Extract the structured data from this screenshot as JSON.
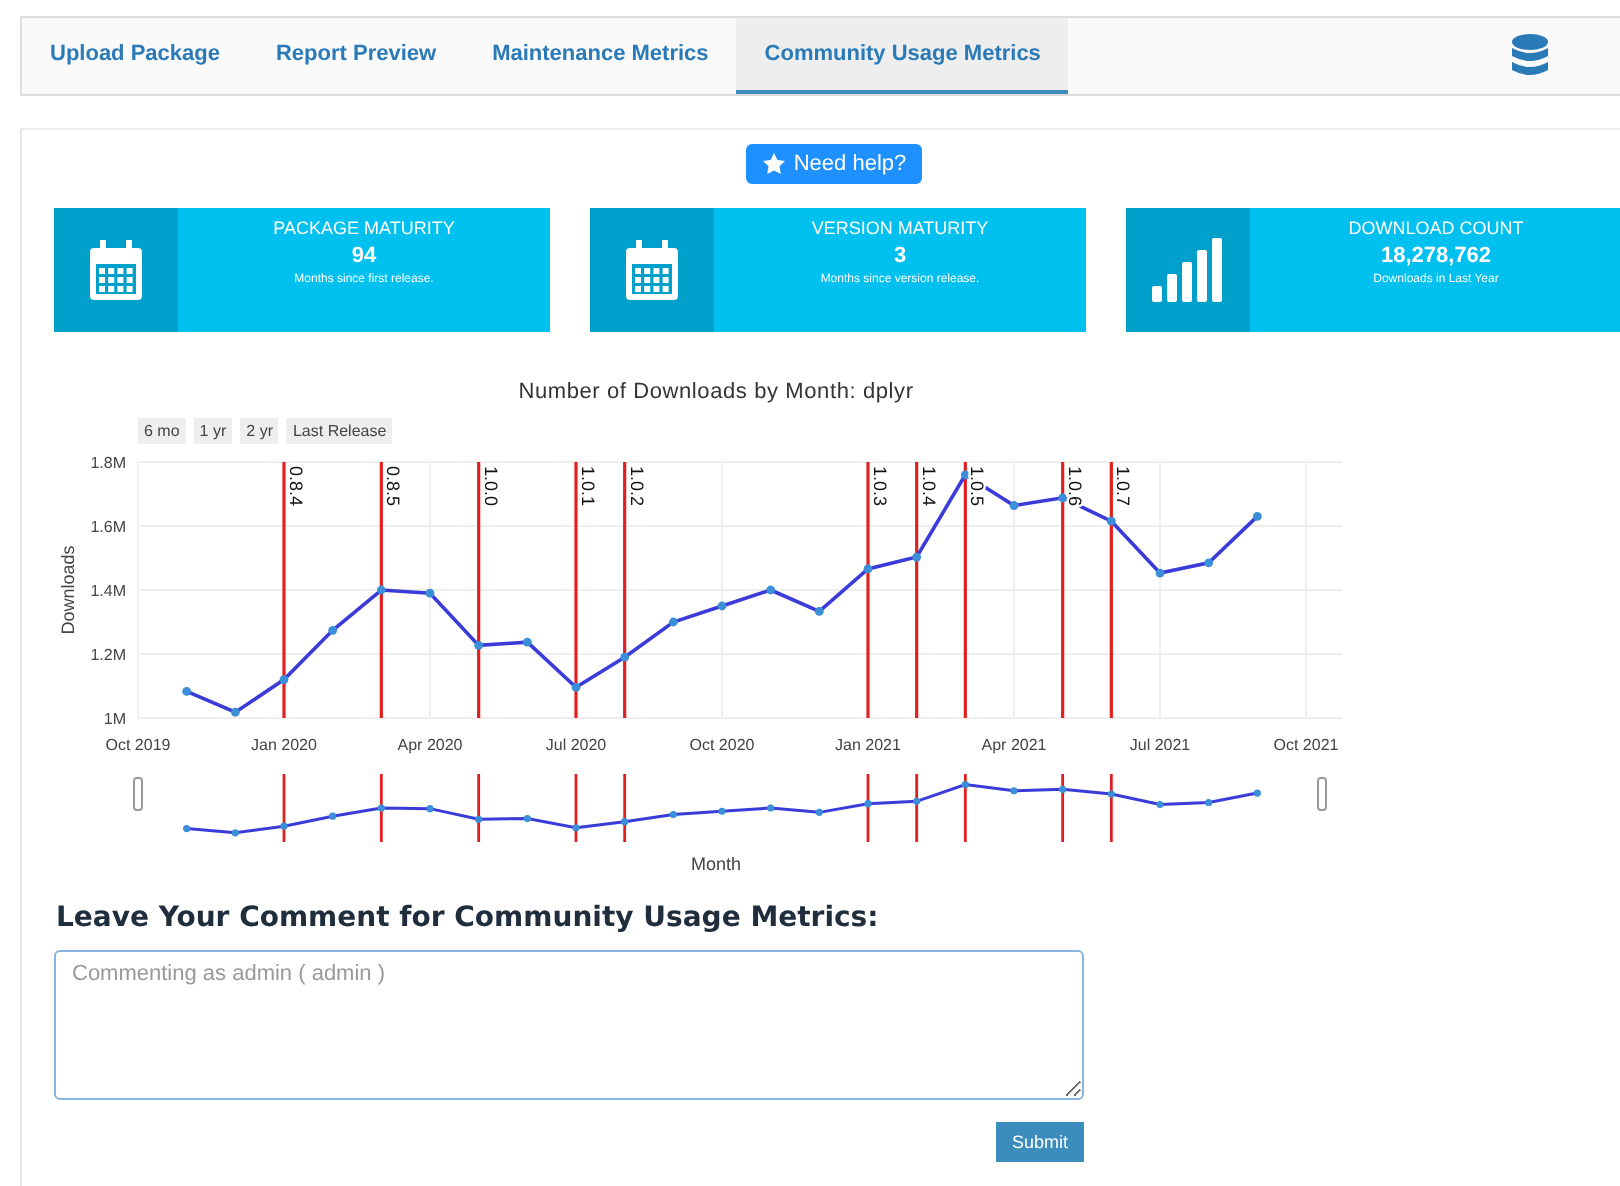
{
  "tabs": [
    {
      "label": "Upload Package",
      "selected": false
    },
    {
      "label": "Report Preview",
      "selected": false
    },
    {
      "label": "Maintenance Metrics",
      "selected": false
    },
    {
      "label": "Community Usage Metrics",
      "selected": true
    }
  ],
  "help_button": "Need help?",
  "cards": [
    {
      "kind": "calendar",
      "title": "PACKAGE MATURITY",
      "value": "94",
      "caption": "Months since first release."
    },
    {
      "kind": "calendar",
      "title": "VERSION MATURITY",
      "value": "3",
      "caption": "Months since version release."
    },
    {
      "kind": "bars",
      "title": "DOWNLOAD COUNT",
      "value": "18,278,762",
      "caption": "Downloads in Last Year"
    }
  ],
  "range_buttons": [
    "6 mo",
    "1 yr",
    "2 yr",
    "Last Release"
  ],
  "chart": {
    "below_slider_label": "Month",
    "chart_data": {
      "type": "line",
      "title": "Number of Downloads by Month: dplyr",
      "ylabel": "Downloads",
      "x": [
        "2019-11",
        "2019-12",
        "2020-01",
        "2020-02",
        "2020-03",
        "2020-04",
        "2020-05",
        "2020-06",
        "2020-07",
        "2020-08",
        "2020-09",
        "2020-10",
        "2020-11",
        "2020-12",
        "2021-01",
        "2021-02",
        "2021-03",
        "2021-04",
        "2021-05",
        "2021-06",
        "2021-07",
        "2021-08",
        "2021-09"
      ],
      "series": [
        {
          "color": "#3b3bd9",
          "marker": "circle",
          "values": [
            1083000,
            1018000,
            1120000,
            1274000,
            1400000,
            1390000,
            1227000,
            1237000,
            1096000,
            1190000,
            1300000,
            1350000,
            1400000,
            1333000,
            1466000,
            1503000,
            1760000,
            1664000,
            1688000,
            1615000,
            1453000,
            1485000,
            1630000
          ]
        }
      ],
      "xlim": [
        "2019-10",
        "2021-10"
      ],
      "ylim": [
        1000000,
        1800000
      ],
      "grid": true,
      "xticks": [
        {
          "value": "2019-10",
          "label": "Oct 2019"
        },
        {
          "value": "2020-01",
          "label": "Jan 2020"
        },
        {
          "value": "2020-04",
          "label": "Apr 2020"
        },
        {
          "value": "2020-07",
          "label": "Jul 2020"
        },
        {
          "value": "2020-10",
          "label": "Oct 2020"
        },
        {
          "value": "2021-01",
          "label": "Jan 2021"
        },
        {
          "value": "2021-04",
          "label": "Apr 2021"
        },
        {
          "value": "2021-07",
          "label": "Jul 2021"
        },
        {
          "value": "2021-10",
          "label": "Oct 2021"
        }
      ],
      "yticks": [
        {
          "value": 1000000,
          "label": "1M"
        },
        {
          "value": 1200000,
          "label": "1.2M"
        },
        {
          "value": 1400000,
          "label": "1.4M"
        },
        {
          "value": 1600000,
          "label": "1.6M"
        },
        {
          "value": 1800000,
          "label": "1.8M"
        }
      ],
      "ref_lines": [
        {
          "axis": "x",
          "value": "2020-01",
          "label": "0.8.4"
        },
        {
          "axis": "x",
          "value": "2020-03",
          "label": "0.8.5"
        },
        {
          "axis": "x",
          "value": "2020-05",
          "label": "1.0.0"
        },
        {
          "axis": "x",
          "value": "2020-07",
          "label": "1.0.1"
        },
        {
          "axis": "x",
          "value": "2020-08",
          "label": "1.0.2"
        },
        {
          "axis": "x",
          "value": "2021-01",
          "label": "1.0.3"
        },
        {
          "axis": "x",
          "value": "2021-02",
          "label": "1.0.4"
        },
        {
          "axis": "x",
          "value": "2021-03",
          "label": "1.0.5"
        },
        {
          "axis": "x",
          "value": "2021-05",
          "label": "1.0.6"
        },
        {
          "axis": "x",
          "value": "2021-06",
          "label": "1.0.7"
        }
      ]
    }
  },
  "comment": {
    "heading": "Leave Your Comment for Community Usage Metrics:",
    "placeholder": "Commenting as admin ( admin )",
    "submit": "Submit"
  }
}
